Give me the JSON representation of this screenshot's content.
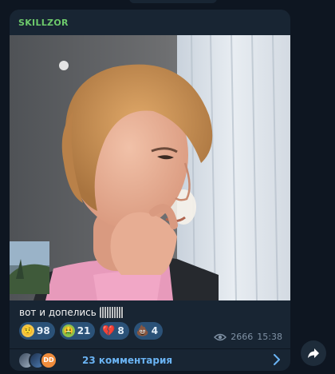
{
  "message": {
    "channel_name": "SKILLZOR",
    "caption": "вот и допелись",
    "reactions": [
      {
        "icon": "hmm-emoji-icon",
        "count": "98",
        "color": "#f3c64a",
        "glyph": "🤨"
      },
      {
        "icon": "vomit-emoji-icon",
        "count": "21",
        "color": "#8fc24a",
        "glyph": "🤮"
      },
      {
        "icon": "broken-heart-icon",
        "count": "8",
        "color": "#e0455a",
        "glyph": "💔"
      },
      {
        "icon": "poop-emoji-icon",
        "count": "4",
        "color": "#8a5a2b",
        "glyph": "💩"
      }
    ],
    "views": "2666",
    "time": "15:38"
  },
  "comments": {
    "label": "23 комментария",
    "avatar_initials": "DD"
  },
  "colors": {
    "background": "#0e1621",
    "bubble": "#182533",
    "channel_name": "#6dc96b",
    "reaction_chip": "#2b5278",
    "link": "#6ab3f3",
    "meta": "#7f91a4"
  }
}
